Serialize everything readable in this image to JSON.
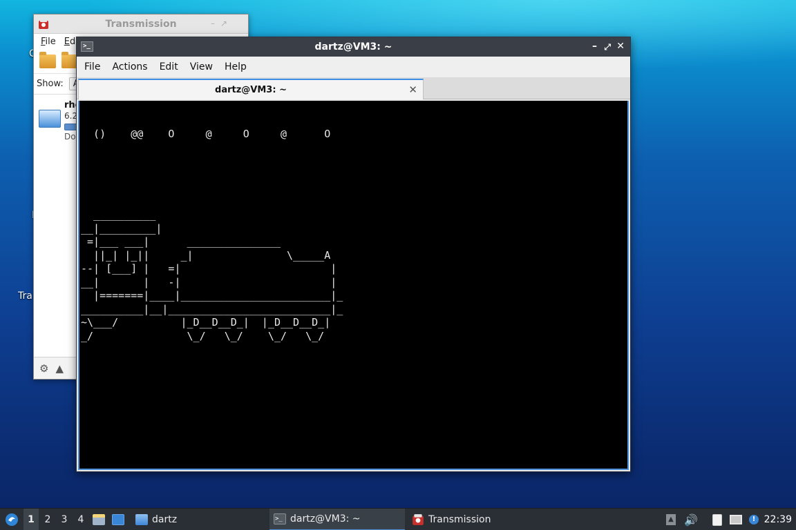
{
  "desktop": {
    "labels": [
      "C",
      "I",
      "Tra"
    ]
  },
  "transmission": {
    "title": "Transmission",
    "menu": [
      "File",
      "Edit"
    ],
    "filter_label": "Show:",
    "filter_value": "A",
    "torrent": {
      "name": "rhe",
      "size": "6.2",
      "status": "Dow"
    }
  },
  "terminal": {
    "title": "dartz@VM3: ~",
    "menu": [
      "File",
      "Actions",
      "Edit",
      "View",
      "Help"
    ],
    "tab_label": "dartz@VM3: ~",
    "screen_lines": [
      "",
      "",
      "  ()    @@    O     @     O     @      O",
      "",
      "",
      "",
      "",
      "",
      "  __________",
      "__|_________|",
      " =|___ ___|      _______________",
      "  ||_| |_||     _|               \\_____A",
      "--| [___] |   =|                        |",
      "__|       |   -|                        |",
      "  |=======|____|________________________|_",
      "__________|__|__________________________|_",
      "~\\___/          |_D__D__D_|  |_D__D__D_|",
      "_/               \\_/   \\_/    \\_/   \\_/"
    ]
  },
  "taskbar": {
    "workspaces": [
      "1",
      "2",
      "3",
      "4"
    ],
    "folder_task": "dartz",
    "terminal_task": "dartz@VM3: ~",
    "transmission_task": "Transmission",
    "clock": "22:39"
  },
  "colors": {
    "accent": "#4a8fd8",
    "terminal_bg": "#000000",
    "titlebar_dark": "#3a3f47",
    "taskbar_bg": "#2a2f36"
  }
}
